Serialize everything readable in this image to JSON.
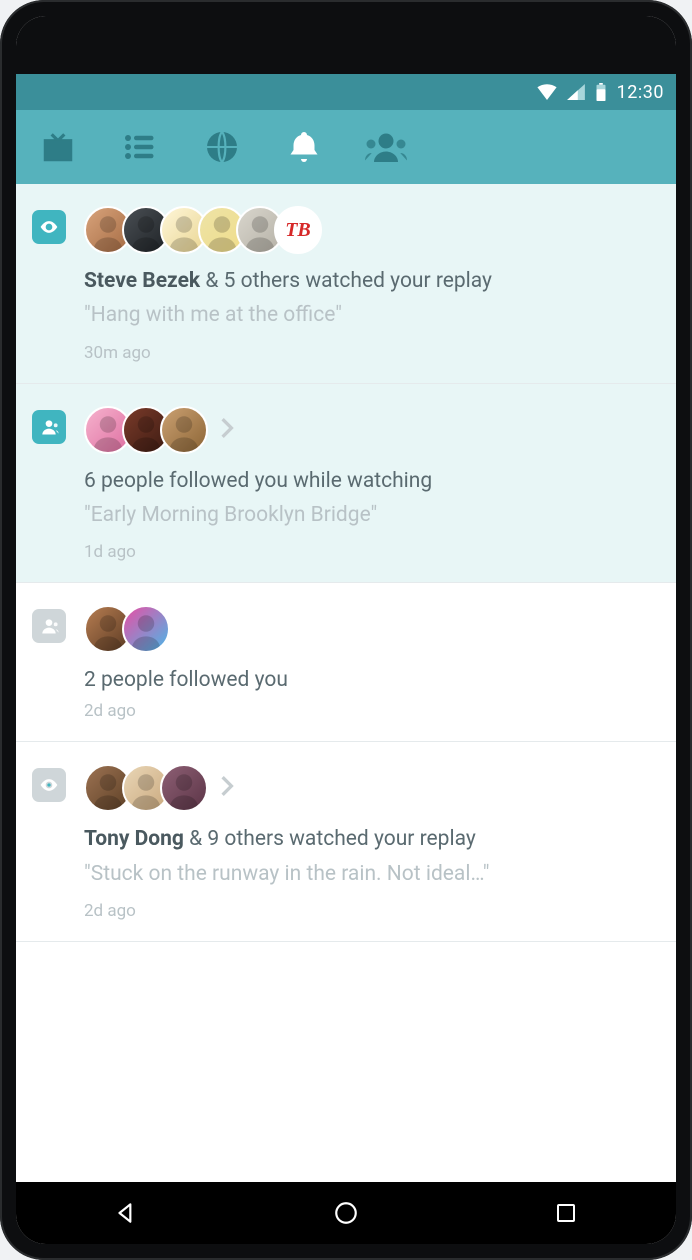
{
  "status": {
    "time": "12:30"
  },
  "tabs": {
    "items": [
      "tv",
      "list",
      "globe",
      "bell",
      "people"
    ],
    "active_index": 3
  },
  "notifications": [
    {
      "unread": true,
      "badge": {
        "type": "eye",
        "color": "teal"
      },
      "avatars": [
        "av-1",
        "av-2",
        "av-3",
        "av-4",
        "av-5",
        "av-6"
      ],
      "avatar_glyph_last": "TB",
      "show_chevron": false,
      "title_bold": "Steve Bezek",
      "title_rest": " & 5 others watched your replay",
      "subtitle": "\"Hang with me at the office\"",
      "time": "30m ago"
    },
    {
      "unread": true,
      "badge": {
        "type": "group",
        "color": "teal"
      },
      "avatars": [
        "av-7",
        "av-8",
        "av-9"
      ],
      "show_chevron": true,
      "title_bold": "",
      "title_rest": "6 people followed you while watching",
      "subtitle": "\"Early Morning Brooklyn Bridge\"",
      "time": "1d ago"
    },
    {
      "unread": false,
      "badge": {
        "type": "group",
        "color": "gray"
      },
      "avatars": [
        "av-10",
        "av-11"
      ],
      "show_chevron": false,
      "title_bold": "",
      "title_rest": "2 people followed you",
      "subtitle": "",
      "time": "2d ago"
    },
    {
      "unread": false,
      "badge": {
        "type": "eye",
        "color": "gray"
      },
      "avatars": [
        "av-12",
        "av-13",
        "av-14"
      ],
      "show_chevron": true,
      "title_bold": "Tony Dong",
      "title_rest": " & 9 others watched your replay",
      "subtitle": "\"Stuck on the runway in the rain. Not ideal…\"",
      "time": "2d ago"
    }
  ]
}
